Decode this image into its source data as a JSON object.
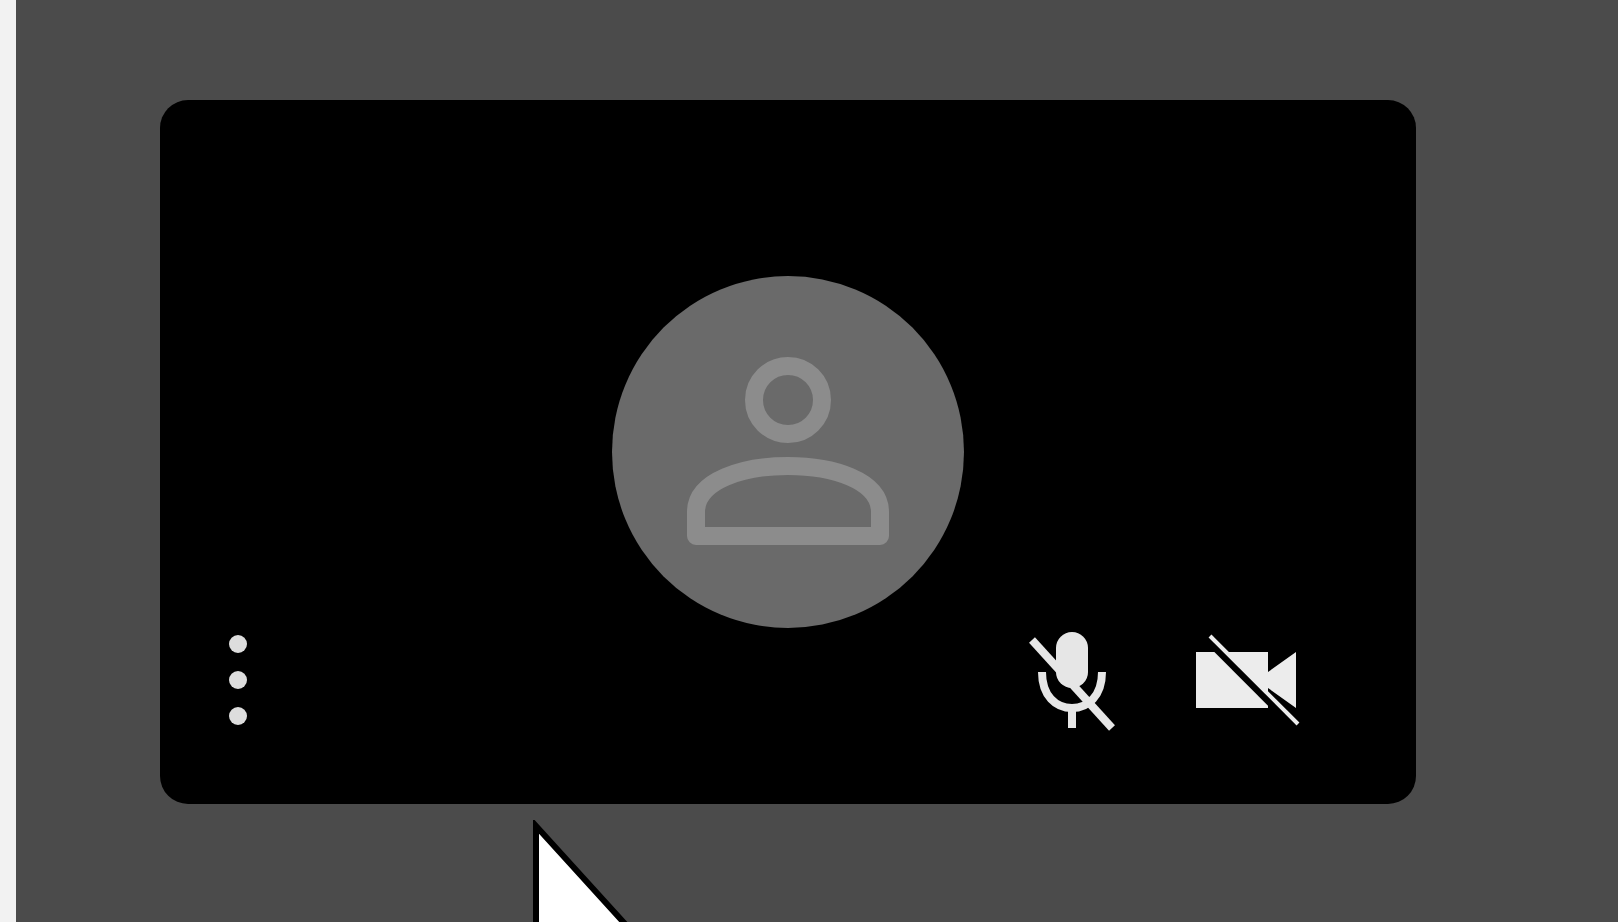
{
  "tile": {
    "mic_muted": true,
    "camera_off": true
  }
}
